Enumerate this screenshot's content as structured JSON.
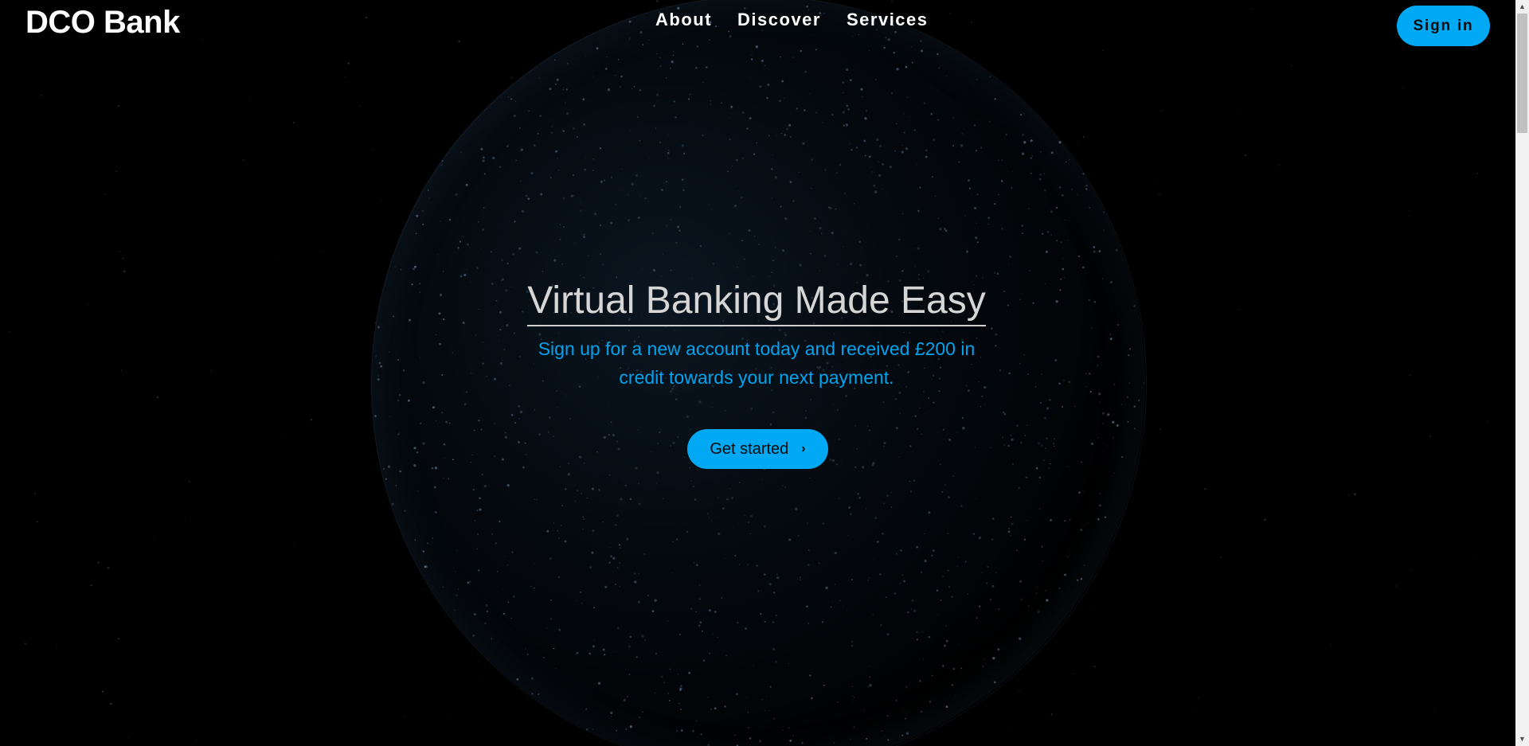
{
  "brand": "DCO Bank",
  "nav": {
    "items": [
      "About",
      "Discover",
      "Services"
    ]
  },
  "header": {
    "signin_label": "Sign in"
  },
  "hero": {
    "title": "Virtual Banking Made Easy",
    "subtitle": "Sign up for a new account today and received £200 in credit towards your next payment.",
    "cta_label": "Get started",
    "cta_icon": "chevron-right-icon"
  },
  "colors": {
    "accent": "#01a9f4",
    "subtitle": "#04a3ee",
    "background": "#000000",
    "title": "#d6d6d6"
  }
}
